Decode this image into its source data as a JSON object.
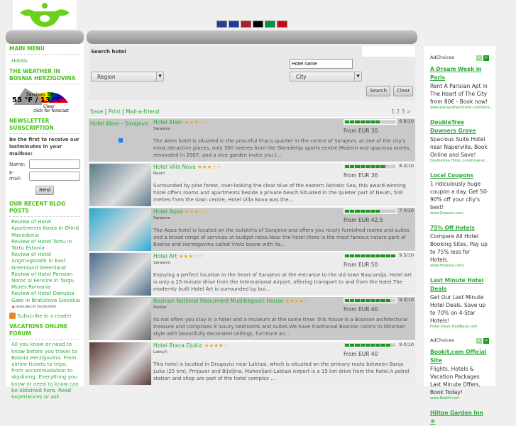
{
  "header": {
    "flags": [
      {
        "name": "english",
        "color": "#2a3f8f"
      },
      {
        "name": "french",
        "color": "#1b3ba0"
      },
      {
        "name": "dutch",
        "color": "#ae1c28"
      },
      {
        "name": "german",
        "color": "#000"
      },
      {
        "name": "italian",
        "color": "#009246"
      },
      {
        "name": "spanish",
        "color": "#c60b1e"
      }
    ]
  },
  "sidebar": {
    "main_menu": "MAIN MENU",
    "menu_items": [
      "Hotels"
    ],
    "weather_title": "THE WEATHER IN BOSNIA HERZIGOVINA",
    "weather": {
      "city": "Sarajevo, BA",
      "temp": "55 °F / 13 °C",
      "cond": "Clear",
      "link": "click for forecast"
    },
    "newsletter_title": "NEWSLETTER SUBSCRIPTION",
    "newsletter_text": "Be the first to receive our lastminutes in your mailbox:",
    "name_label": "Name:",
    "email_label": "E-mail:",
    "send": "Send",
    "blog_title": "OUR RECENT BLOG POSTS",
    "blog_posts": [
      "Review of Hotel Apartments Kosta in Ohrid Macedonia",
      "Review of Hotel Tartu in Tartu Estonia",
      "Review of Hotel Angmagssalik in East Greenland Greenland",
      "Review of Hotel Pension Noroc si Fericire in Targu Mures Romania",
      "Review of Hotel Danubia Gate in Bratislava Slovakia"
    ],
    "feedburner": "HEADLINES BY FEEDBURNER",
    "subscribe": "Subscribe in a reader",
    "forum_title": "VACATIONS ONLINE FORUM",
    "forum_text": "All you know or need to know before you travel to Bosnia Herzigovina. From airline tickets to trips, from accommodation to skydiving. Everything you know or need to know can be obtained here. Read experiences or ask"
  },
  "search": {
    "title": "Search hotel",
    "hotel_placeholder": "Hotel name",
    "region": "Region",
    "city": "City",
    "search": "Search",
    "clear": "Clear"
  },
  "links": {
    "save": "Save",
    "print": "Print",
    "mail": "Mail-a-friend",
    "pages": "1 2 3 >"
  },
  "left_label": "Hotel Alem - Sarajevo",
  "hotels": [
    {
      "name": "Hotel Alem",
      "stars": 3,
      "city": "Sarajevo",
      "rating": 6.8,
      "rating_text": "6.8/10",
      "price": "From EUR 30",
      "desc": "The Alem hotel is situated in the peaceful Vraca quarter in the centre of Sarajevo, at one of the city's most attractive places, only 300 metres from the Skenderija sports centre.Modern and spacious rooms, renovated in 2007, and a nice garden invite you t...",
      "color": ""
    },
    {
      "name": "Hotel Villa Nova",
      "stars": 3,
      "city": "Neum",
      "rating": 8.4,
      "rating_text": "8.4/10",
      "price": "From EUR 36",
      "desc": "Surrounded by pine forest, over-looking the clear blue of the eastern Adriatic Sea, this award-winning hotel offers rooms and apartments beside a private beach.Situated in the quieter part of Neum, 500 metres from the town centre, Hotel Villa Nova was the...",
      "color": "#5a7a8a"
    },
    {
      "name": "Hotel Aqua",
      "stars": 3,
      "city": "Sarajevo",
      "rating": 7.4,
      "rating_text": "7.4/10",
      "price": "From EUR 42.5",
      "desc": "The Aqua hotel is located on the outskirts of Sarajevo and offers you nicely furnished rooms and suites and a broad range of services at budget rates.Near the hotel there is the most famous nature park of Bosnia and Herzegovina called Vrelo bosne with its...",
      "color": "#2aa8d0"
    },
    {
      "name": "Hotel Art",
      "stars": 3,
      "city": "Sarajevo",
      "rating": 9.5,
      "rating_text": "9.5/10",
      "price": "From EUR 50",
      "desc": "Enjoying a perfect location in the heart of Sarajevo at the entrance to the old town Bascarsija, Hotel Art is only a 15-minute drive from the International Airport, offering transport to and from the hotel.The modernly built Hotel Art is surrounded by bui...",
      "color": "#4a6a8a"
    },
    {
      "name": "Bosnian National Monument Muslibegovic House",
      "stars": 4,
      "city": "Mostar",
      "rating": 9.3,
      "rating_text": "9.3/10",
      "price": "From EUR 40",
      "desc": "Its not often you stay in a hotel and a museum at the same time: this house is a Bosnian architectural treasure and comprises 8 luxury bedrooms and suites.We have traditional Bosnian rooms in Ottoman style with beautifully decorated ceilings, furniture an...",
      "color": "#6a6a6a"
    },
    {
      "name": "Hotel Braca Djukic",
      "stars": 4,
      "city": "Lakta?i",
      "rating": 9.0,
      "rating_text": "9.0/10",
      "price": "From EUR 40",
      "desc": "This hotel is located in Drugovici near Laktasi, which is situated on the primary route between Banja Luka (25 km), Prnjavor and Bijeljina. Mahovljani-Laktasi Airport is a 15 km drive from the hotel.A petrol station and shop are part of the hotel complex ...",
      "color": "#5a3a34"
    }
  ],
  "ads": {
    "adchoices": "AdChoices",
    "items": [
      {
        "title": "A Dream Week in Paris",
        "body": "Rent A Parisian Apt in The Heart of The City from 80€ - Book now!",
        "url": "www.parisauthentment.com/Paris..."
      },
      {
        "title": "DoubleTree Downers Grove",
        "body": "Spacious Suite Hotel near Naperville. Book Online and Save!",
        "url": "Doubletree.Hilton.com/Downer..."
      },
      {
        "title": "Local Coupons",
        "body": "1 ridiculously huge coupon a day. Get 50-90% off your city's best!",
        "url": "www.Groupon.com"
      },
      {
        "title": "75% Off Hotels",
        "body": "Compare All Hotel Booking Sites, Pay up to 75% less for Hotels.",
        "url": "www.Hotelsio.com/"
      },
      {
        "title": "Last Minute Hotel Deals",
        "body": "Get Our Last Minute Hotel Deals. Save up to 70% on 4-Star Hotels!",
        "url": "Hotel-Deals.DealBase.com"
      }
    ],
    "items2": [
      {
        "title": "Bookit.com Official Site",
        "body": "Flights, Hotels & Vacation Packages Last Minute Offers, Book Today!",
        "url": "www.BookIt.com"
      },
      {
        "title": "Hilton Garden Inn ®",
        "body": "",
        "url": ""
      }
    ]
  }
}
